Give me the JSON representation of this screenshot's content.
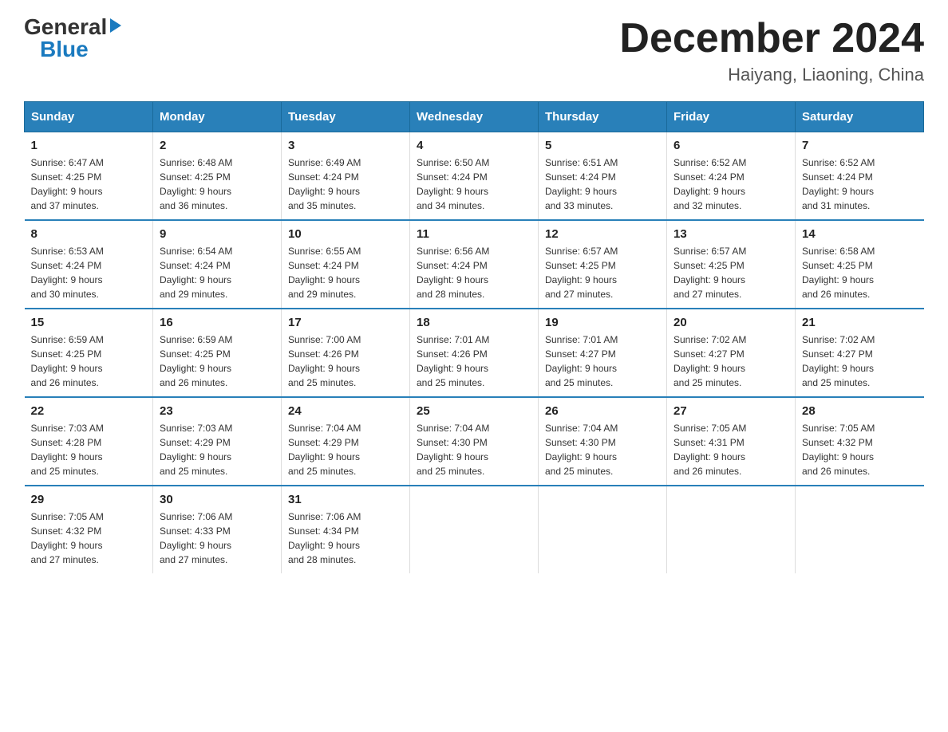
{
  "header": {
    "logo_general": "General",
    "logo_blue": "Blue",
    "month_title": "December 2024",
    "location": "Haiyang, Liaoning, China"
  },
  "weekdays": [
    "Sunday",
    "Monday",
    "Tuesday",
    "Wednesday",
    "Thursday",
    "Friday",
    "Saturday"
  ],
  "weeks": [
    [
      {
        "day": "1",
        "sunrise": "6:47 AM",
        "sunset": "4:25 PM",
        "daylight": "9 hours and 37 minutes."
      },
      {
        "day": "2",
        "sunrise": "6:48 AM",
        "sunset": "4:25 PM",
        "daylight": "9 hours and 36 minutes."
      },
      {
        "day": "3",
        "sunrise": "6:49 AM",
        "sunset": "4:24 PM",
        "daylight": "9 hours and 35 minutes."
      },
      {
        "day": "4",
        "sunrise": "6:50 AM",
        "sunset": "4:24 PM",
        "daylight": "9 hours and 34 minutes."
      },
      {
        "day": "5",
        "sunrise": "6:51 AM",
        "sunset": "4:24 PM",
        "daylight": "9 hours and 33 minutes."
      },
      {
        "day": "6",
        "sunrise": "6:52 AM",
        "sunset": "4:24 PM",
        "daylight": "9 hours and 32 minutes."
      },
      {
        "day": "7",
        "sunrise": "6:52 AM",
        "sunset": "4:24 PM",
        "daylight": "9 hours and 31 minutes."
      }
    ],
    [
      {
        "day": "8",
        "sunrise": "6:53 AM",
        "sunset": "4:24 PM",
        "daylight": "9 hours and 30 minutes."
      },
      {
        "day": "9",
        "sunrise": "6:54 AM",
        "sunset": "4:24 PM",
        "daylight": "9 hours and 29 minutes."
      },
      {
        "day": "10",
        "sunrise": "6:55 AM",
        "sunset": "4:24 PM",
        "daylight": "9 hours and 29 minutes."
      },
      {
        "day": "11",
        "sunrise": "6:56 AM",
        "sunset": "4:24 PM",
        "daylight": "9 hours and 28 minutes."
      },
      {
        "day": "12",
        "sunrise": "6:57 AM",
        "sunset": "4:25 PM",
        "daylight": "9 hours and 27 minutes."
      },
      {
        "day": "13",
        "sunrise": "6:57 AM",
        "sunset": "4:25 PM",
        "daylight": "9 hours and 27 minutes."
      },
      {
        "day": "14",
        "sunrise": "6:58 AM",
        "sunset": "4:25 PM",
        "daylight": "9 hours and 26 minutes."
      }
    ],
    [
      {
        "day": "15",
        "sunrise": "6:59 AM",
        "sunset": "4:25 PM",
        "daylight": "9 hours and 26 minutes."
      },
      {
        "day": "16",
        "sunrise": "6:59 AM",
        "sunset": "4:25 PM",
        "daylight": "9 hours and 26 minutes."
      },
      {
        "day": "17",
        "sunrise": "7:00 AM",
        "sunset": "4:26 PM",
        "daylight": "9 hours and 25 minutes."
      },
      {
        "day": "18",
        "sunrise": "7:01 AM",
        "sunset": "4:26 PM",
        "daylight": "9 hours and 25 minutes."
      },
      {
        "day": "19",
        "sunrise": "7:01 AM",
        "sunset": "4:27 PM",
        "daylight": "9 hours and 25 minutes."
      },
      {
        "day": "20",
        "sunrise": "7:02 AM",
        "sunset": "4:27 PM",
        "daylight": "9 hours and 25 minutes."
      },
      {
        "day": "21",
        "sunrise": "7:02 AM",
        "sunset": "4:27 PM",
        "daylight": "9 hours and 25 minutes."
      }
    ],
    [
      {
        "day": "22",
        "sunrise": "7:03 AM",
        "sunset": "4:28 PM",
        "daylight": "9 hours and 25 minutes."
      },
      {
        "day": "23",
        "sunrise": "7:03 AM",
        "sunset": "4:29 PM",
        "daylight": "9 hours and 25 minutes."
      },
      {
        "day": "24",
        "sunrise": "7:04 AM",
        "sunset": "4:29 PM",
        "daylight": "9 hours and 25 minutes."
      },
      {
        "day": "25",
        "sunrise": "7:04 AM",
        "sunset": "4:30 PM",
        "daylight": "9 hours and 25 minutes."
      },
      {
        "day": "26",
        "sunrise": "7:04 AM",
        "sunset": "4:30 PM",
        "daylight": "9 hours and 25 minutes."
      },
      {
        "day": "27",
        "sunrise": "7:05 AM",
        "sunset": "4:31 PM",
        "daylight": "9 hours and 26 minutes."
      },
      {
        "day": "28",
        "sunrise": "7:05 AM",
        "sunset": "4:32 PM",
        "daylight": "9 hours and 26 minutes."
      }
    ],
    [
      {
        "day": "29",
        "sunrise": "7:05 AM",
        "sunset": "4:32 PM",
        "daylight": "9 hours and 27 minutes."
      },
      {
        "day": "30",
        "sunrise": "7:06 AM",
        "sunset": "4:33 PM",
        "daylight": "9 hours and 27 minutes."
      },
      {
        "day": "31",
        "sunrise": "7:06 AM",
        "sunset": "4:34 PM",
        "daylight": "9 hours and 28 minutes."
      },
      null,
      null,
      null,
      null
    ]
  ],
  "labels": {
    "sunrise": "Sunrise:",
    "sunset": "Sunset:",
    "daylight": "Daylight:"
  }
}
